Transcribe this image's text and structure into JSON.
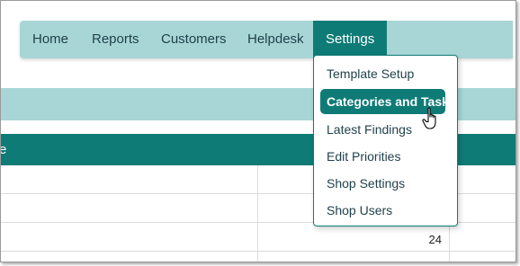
{
  "nav": {
    "items": [
      {
        "label": "Home"
      },
      {
        "label": "Reports"
      },
      {
        "label": "Customers"
      },
      {
        "label": "Helpdesk"
      },
      {
        "label": "Settings",
        "active": true
      }
    ]
  },
  "table": {
    "header_fragment": "e",
    "value": "24"
  },
  "settings_menu": {
    "items": [
      {
        "label": "Template Setup"
      },
      {
        "label": "Categories and Tasks",
        "highlighted": true
      },
      {
        "label": "Latest Findings"
      },
      {
        "label": "Edit Priorities"
      },
      {
        "label": "Shop Settings"
      },
      {
        "label": "Shop Users"
      }
    ]
  },
  "colors": {
    "nav_bg": "#a8d6d6",
    "accent": "#0f7b76",
    "text": "#1f3f4a"
  },
  "icons": {
    "cursor": "hand-pointer-icon"
  }
}
